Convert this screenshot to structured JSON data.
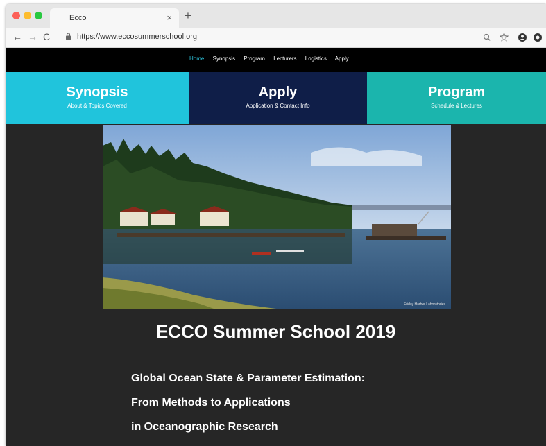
{
  "browser": {
    "tab_title": "Ecco",
    "tab_close": "×",
    "new_tab": "+",
    "url": "https://www.eccosummerschool.org",
    "nav": {
      "back": "←",
      "forward": "→",
      "reload": "C"
    },
    "icons": {
      "zoom": "search-icon",
      "star": "star-icon",
      "account": "account-icon",
      "extension": "extension-icon"
    }
  },
  "site_nav": {
    "items": [
      "Home",
      "Synopsis",
      "Program",
      "Lecturers",
      "Logistics",
      "Apply"
    ],
    "active": "Home",
    "active_color": "#2ec7e0"
  },
  "banner": {
    "synopsis": {
      "title": "Synopsis",
      "subtitle": "About & Topics Covered",
      "color": "#20c4dc"
    },
    "apply": {
      "title": "Apply",
      "subtitle": "Application & Contact Info",
      "color": "#0f1e48"
    },
    "program": {
      "title": "Program",
      "subtitle": "Schedule & Lectures",
      "color": "#1bb5ad"
    }
  },
  "hero": {
    "credit": "Friday Harbor Laboratories"
  },
  "main": {
    "heading": "ECCO Summer School 2019",
    "subtitle_lines": [
      "Global Ocean State & Parameter Estimation:",
      "From Methods to Applications",
      "in Oceanographic Research"
    ]
  }
}
